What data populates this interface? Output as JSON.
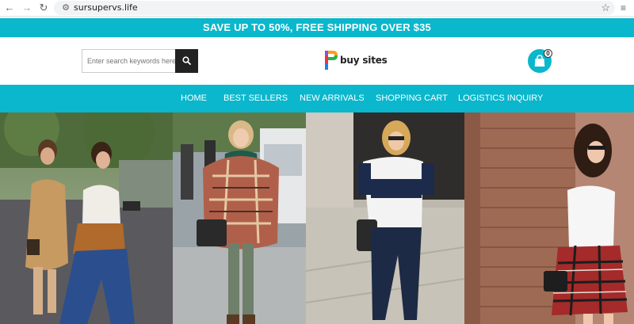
{
  "browser": {
    "url": "sursupervs.life",
    "back_icon": "arrow-left-icon",
    "forward_icon": "arrow-right-icon",
    "reload_icon": "reload-icon",
    "site_info_icon": "tune-icon",
    "bookmark_icon": "star-icon",
    "extension_icon": "playlist-icon"
  },
  "promo": {
    "text": "SAVE UP TO 50%, FREE SHIPPING OVER $35"
  },
  "header": {
    "search": {
      "placeholder": "Enter search keywords here",
      "value": ""
    },
    "logo": {
      "mark": "P",
      "text": "buy sites"
    },
    "cart": {
      "count": "0"
    }
  },
  "nav": {
    "items": [
      {
        "label": "HOME"
      },
      {
        "label": "BEST SELLERS"
      },
      {
        "label": "NEW ARRIVALS"
      },
      {
        "label": "SHOPPING CART"
      },
      {
        "label": "LOGISTICS INQUIRY"
      }
    ]
  },
  "hero": {
    "images": [
      {
        "name": "street-fashion-two-women"
      },
      {
        "name": "plaid-poncho-woman"
      },
      {
        "name": "striped-tee-woman"
      },
      {
        "name": "white-tee-plaid-skirt-woman"
      }
    ]
  },
  "colors": {
    "accent": "#0ab7cc",
    "dark": "#222222"
  }
}
